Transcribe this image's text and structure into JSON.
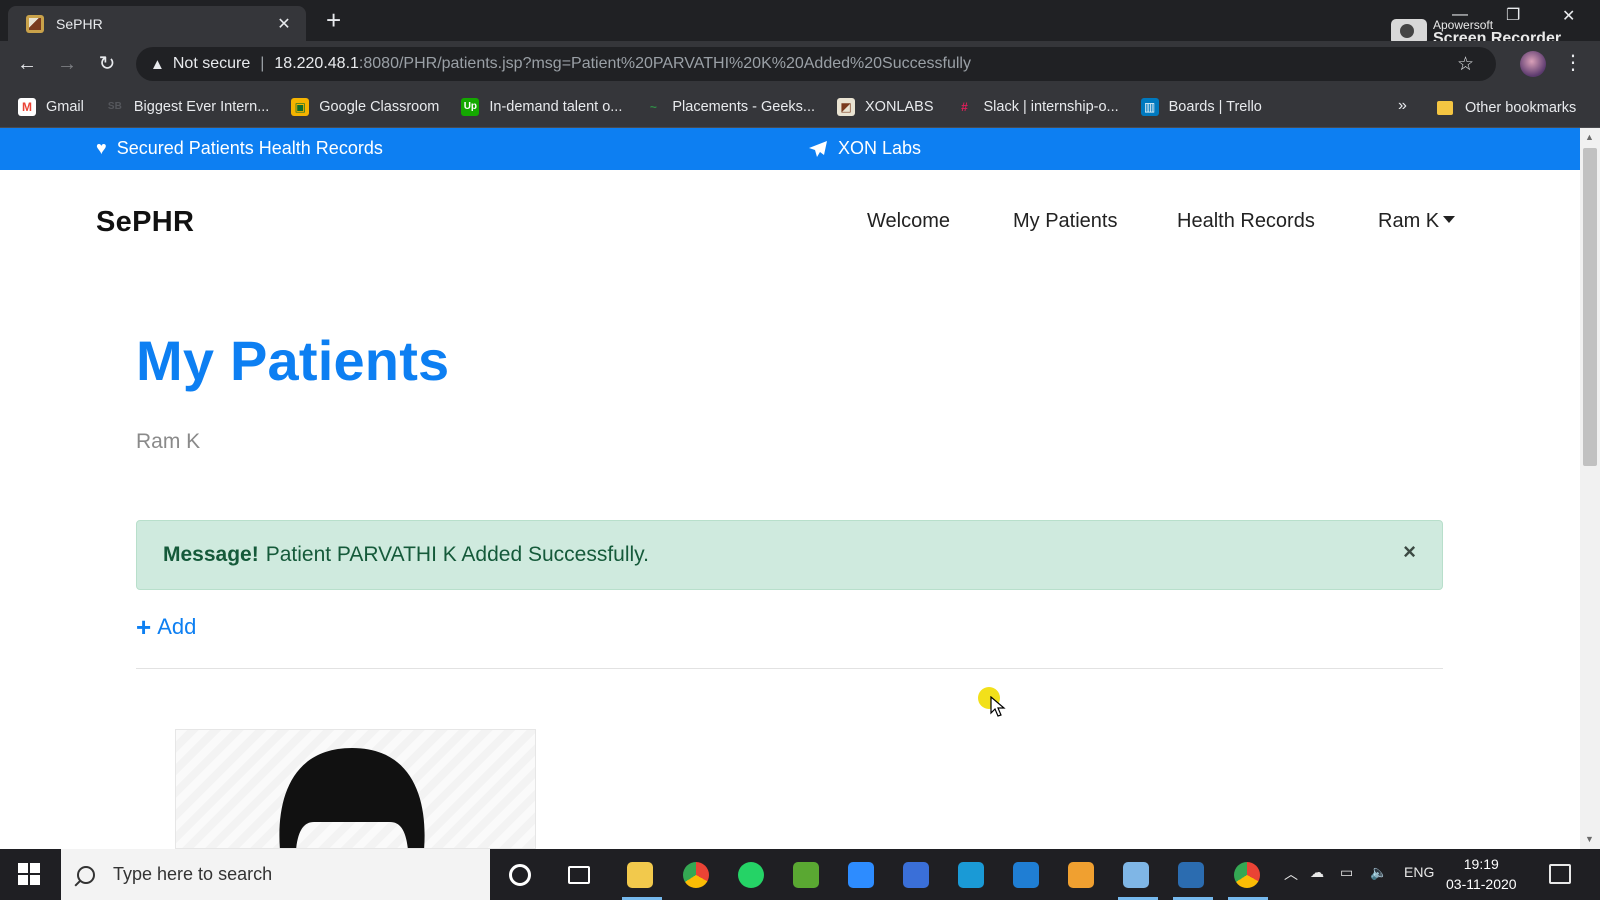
{
  "browser": {
    "tab_title": "SePHR",
    "tab_close": "✕",
    "new_tab": "+",
    "address": {
      "security_label": "Not secure",
      "host": "18.220.48.1",
      "path": ":8080/PHR/patients.jsp?msg=Patient%20PARVATHI%20K%20Added%20Successfully"
    },
    "recorder": {
      "line1": "Apowersoft",
      "line2": "Screen Recorder"
    },
    "bookmarks": [
      {
        "label": "Gmail",
        "icon": "gmail-icon",
        "color": "#ea4335",
        "glyph": "M"
      },
      {
        "label": "Biggest Ever Intern...",
        "icon": "sb-icon",
        "color": "#35363a",
        "glyph": "SB"
      },
      {
        "label": "Google Classroom",
        "icon": "classroom-icon",
        "color": "#f5b400",
        "glyph": "▣"
      },
      {
        "label": "In-demand talent o...",
        "icon": "upwork-icon",
        "color": "#14a800",
        "glyph": "Up"
      },
      {
        "label": "Placements - Geeks...",
        "icon": "gfg-icon",
        "color": "#35363a",
        "glyph": "~"
      },
      {
        "label": "XONLABS",
        "icon": "xonlabs-icon",
        "color": "#c9a24a",
        "glyph": "◩"
      },
      {
        "label": "Slack | internship-o...",
        "icon": "slack-icon",
        "color": "#611f69",
        "glyph": "#"
      },
      {
        "label": "Boards | Trello",
        "icon": "trello-icon",
        "color": "#0079bf",
        "glyph": "▥"
      }
    ],
    "overflow": "»",
    "other_bookmarks": "Other bookmarks"
  },
  "page": {
    "topbar": {
      "left_text": "Secured Patients Health Records",
      "center_text": "XON Labs"
    },
    "brand": "SePHR",
    "nav": [
      {
        "label": "Welcome"
      },
      {
        "label": "My Patients"
      },
      {
        "label": "Health Records"
      },
      {
        "label": "Ram K"
      }
    ],
    "title": "My Patients",
    "subtitle": "Ram K",
    "alert": {
      "strong": "Message!",
      "text": "Patient PARVATHI K Added Successfully.",
      "close": "×"
    },
    "add_label": "Add"
  },
  "taskbar": {
    "search_placeholder": "Type here to search",
    "language": "ENG",
    "time": "19:19",
    "date": "03-11-2020"
  },
  "colors": {
    "accent": "#0d7ff2",
    "alert_bg": "#cfeade",
    "alert_text": "#155a3a"
  }
}
